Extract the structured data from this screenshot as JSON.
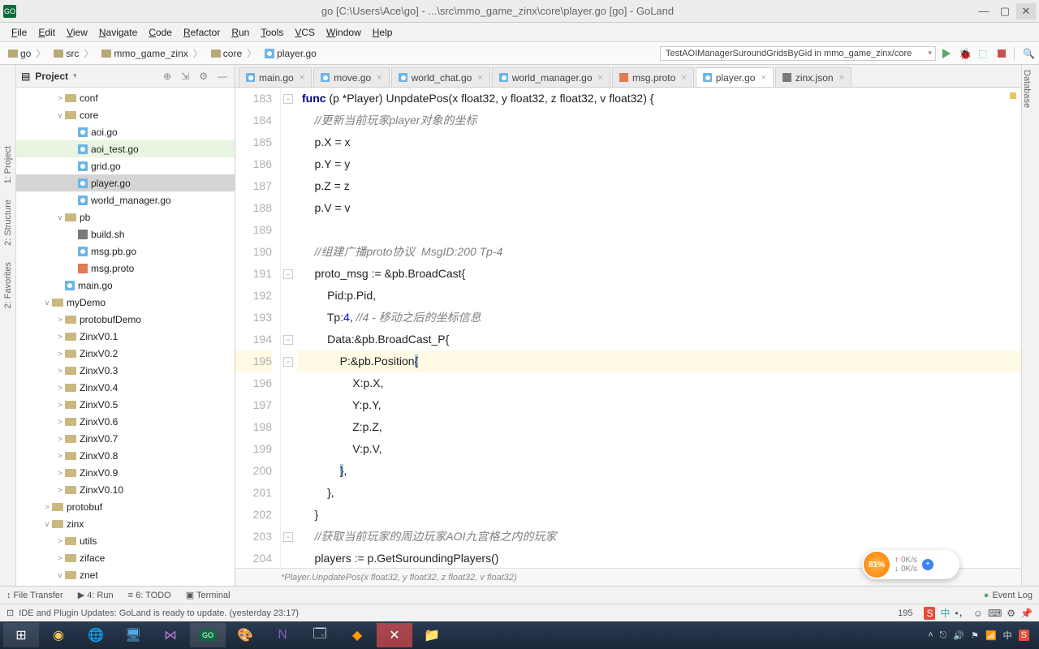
{
  "window": {
    "title": "go [C:\\Users\\Ace\\go] - ...\\src\\mmo_game_zinx\\core\\player.go [go] - GoLand",
    "app_badge": "GO"
  },
  "menu": [
    "File",
    "Edit",
    "View",
    "Navigate",
    "Code",
    "Refactor",
    "Run",
    "Tools",
    "VCS",
    "Window",
    "Help"
  ],
  "breadcrumb": [
    "go",
    "src",
    "mmo_game_zinx",
    "core",
    "player.go"
  ],
  "run_config": "TestAOIManagerSuroundGridsByGid in mmo_game_zinx/core",
  "project": {
    "title": "Project",
    "tree": [
      {
        "d": 3,
        "exp": ">",
        "kind": "folder",
        "label": "conf"
      },
      {
        "d": 3,
        "exp": "v",
        "kind": "folder",
        "label": "core"
      },
      {
        "d": 4,
        "exp": "",
        "kind": "gofile",
        "label": "aoi.go"
      },
      {
        "d": 4,
        "exp": "",
        "kind": "gofile",
        "label": "aoi_test.go",
        "hl": true
      },
      {
        "d": 4,
        "exp": "",
        "kind": "gofile",
        "label": "grid.go"
      },
      {
        "d": 4,
        "exp": "",
        "kind": "gofile",
        "label": "player.go",
        "sel": true
      },
      {
        "d": 4,
        "exp": "",
        "kind": "gofile",
        "label": "world_manager.go"
      },
      {
        "d": 3,
        "exp": "v",
        "kind": "folder",
        "label": "pb"
      },
      {
        "d": 4,
        "exp": "",
        "kind": "shfile",
        "label": "build.sh"
      },
      {
        "d": 4,
        "exp": "",
        "kind": "gofile",
        "label": "msg.pb.go"
      },
      {
        "d": 4,
        "exp": "",
        "kind": "protofile",
        "label": "msg.proto"
      },
      {
        "d": 3,
        "exp": "",
        "kind": "gofile",
        "label": "main.go"
      },
      {
        "d": 2,
        "exp": "v",
        "kind": "folder",
        "label": "myDemo"
      },
      {
        "d": 3,
        "exp": ">",
        "kind": "folder",
        "label": "protobufDemo"
      },
      {
        "d": 3,
        "exp": ">",
        "kind": "folder",
        "label": "ZinxV0.1"
      },
      {
        "d": 3,
        "exp": ">",
        "kind": "folder",
        "label": "ZinxV0.2"
      },
      {
        "d": 3,
        "exp": ">",
        "kind": "folder",
        "label": "ZinxV0.3"
      },
      {
        "d": 3,
        "exp": ">",
        "kind": "folder",
        "label": "ZinxV0.4"
      },
      {
        "d": 3,
        "exp": ">",
        "kind": "folder",
        "label": "ZinxV0.5"
      },
      {
        "d": 3,
        "exp": ">",
        "kind": "folder",
        "label": "ZinxV0.6"
      },
      {
        "d": 3,
        "exp": ">",
        "kind": "folder",
        "label": "ZinxV0.7"
      },
      {
        "d": 3,
        "exp": ">",
        "kind": "folder",
        "label": "ZinxV0.8"
      },
      {
        "d": 3,
        "exp": ">",
        "kind": "folder",
        "label": "ZinxV0.9"
      },
      {
        "d": 3,
        "exp": ">",
        "kind": "folder",
        "label": "ZinxV0.10"
      },
      {
        "d": 2,
        "exp": ">",
        "kind": "folder",
        "label": "protobuf"
      },
      {
        "d": 2,
        "exp": "v",
        "kind": "folder",
        "label": "zinx"
      },
      {
        "d": 3,
        "exp": ">",
        "kind": "folder",
        "label": "utils"
      },
      {
        "d": 3,
        "exp": ">",
        "kind": "folder",
        "label": "ziface"
      },
      {
        "d": 3,
        "exp": "v",
        "kind": "folder",
        "label": "znet"
      }
    ]
  },
  "tabs": [
    {
      "label": "main.go",
      "kind": "gofile"
    },
    {
      "label": "move.go",
      "kind": "gofile"
    },
    {
      "label": "world_chat.go",
      "kind": "gofile"
    },
    {
      "label": "world_manager.go",
      "kind": "gofile"
    },
    {
      "label": "msg.proto",
      "kind": "protofile"
    },
    {
      "label": "player.go",
      "kind": "gofile",
      "active": true
    },
    {
      "label": "zinx.json",
      "kind": "shfile"
    }
  ],
  "code": {
    "start": 183,
    "lines": [
      {
        "html": "<span class='kw'>func</span> (p *Player) UnpdatePos(x float32, y float32, z float32, v float32) {"
      },
      {
        "html": "    <span class='str'>//更新当前玩家player对象的坐标</span>"
      },
      {
        "html": "    p.X = x"
      },
      {
        "html": "    p.Y = y"
      },
      {
        "html": "    p.Z = z"
      },
      {
        "html": "    p.V = v"
      },
      {
        "html": ""
      },
      {
        "html": "    <span class='str'>//组建广播proto协议  MsgID:200 Tp-4</span>"
      },
      {
        "html": "    proto_msg := &pb.BroadCast{"
      },
      {
        "html": "        Pid:p.Pid,"
      },
      {
        "html": "        Tp:<span class='num'>4</span>, <span class='str'>//4 - 移动之后的坐标信息</span>"
      },
      {
        "html": "        Data:&pb.BroadCast_P{"
      },
      {
        "html": "            P:&pb.Position<span class='sel-bg'>{</span>",
        "hl": true
      },
      {
        "html": "                X:p.X,"
      },
      {
        "html": "                Y:p.Y,"
      },
      {
        "html": "                Z:p.Z,"
      },
      {
        "html": "                V:p.V,"
      },
      {
        "html": "            <span class='sel-bg'>}</span>,"
      },
      {
        "html": "        },"
      },
      {
        "html": "    }"
      },
      {
        "html": "    <span class='str'>//获取当前玩家的周边玩家AOI九宫格之内的玩家</span>"
      },
      {
        "html": "    players := p.GetSuroundingPlayers()"
      }
    ],
    "breadcrumb": "*Player.UnpdatePos(x float32, y float32, z float32, v float32)"
  },
  "left_tools": [
    "1: Project",
    "2: Structure",
    "2: Favorites"
  ],
  "right_tool": "Database",
  "bottom_tools": [
    "↕ File Transfer",
    "▶ 4: Run",
    "≡ 6: TODO",
    "▣ Terminal"
  ],
  "event_log": "Event Log",
  "status": {
    "msg": "IDE and Plugin Updates: GoLand is ready to update. (yesterday 23:17)",
    "pos": "195",
    "ime": "中"
  },
  "net": {
    "pct": "81%",
    "up": "0K/s",
    "down": "0K/s"
  }
}
